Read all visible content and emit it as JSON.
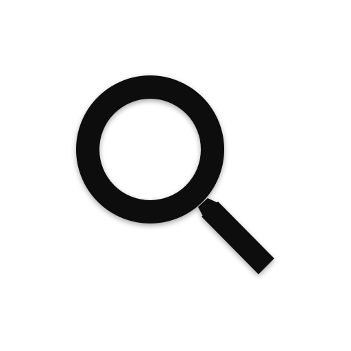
{
  "icon": {
    "name": "search-icon",
    "color": "#0a0a0a",
    "shadow_color": "#000000",
    "background": "#ffffff"
  }
}
